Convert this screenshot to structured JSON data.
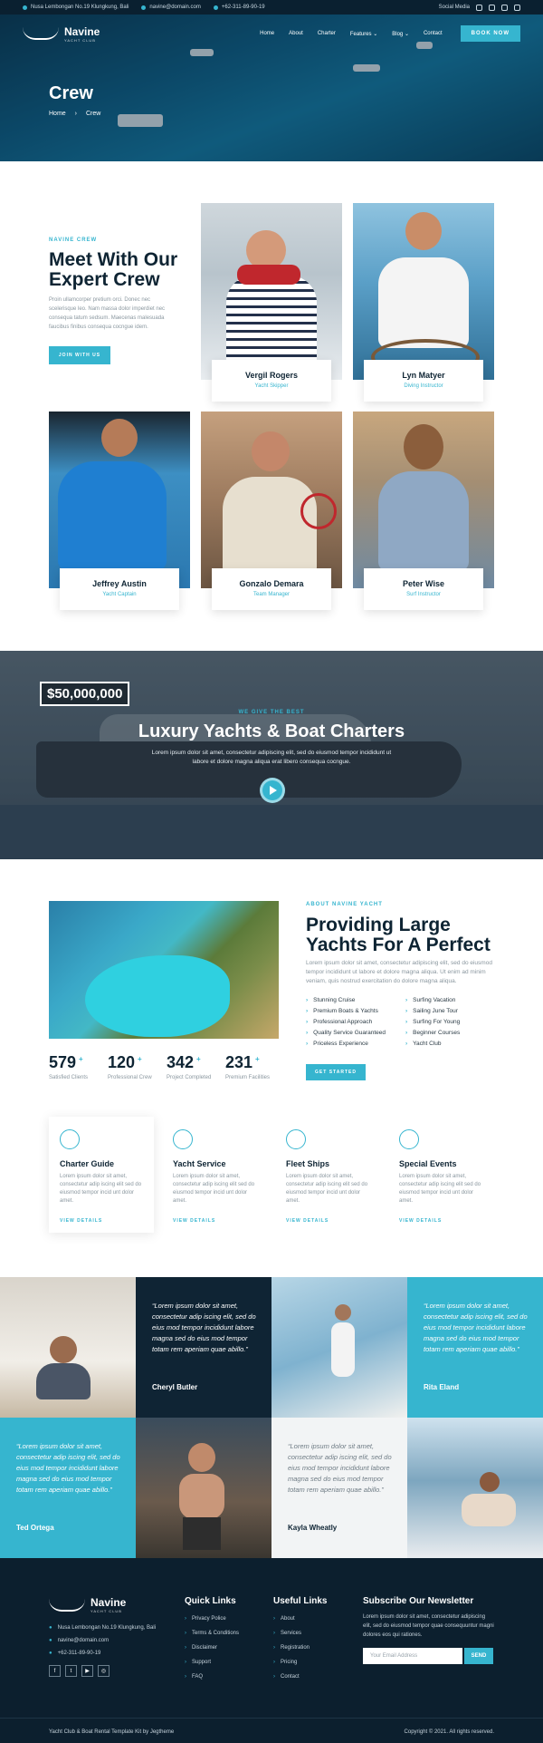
{
  "topbar": {
    "address": "Nusa Lembongan No.19 Klungkung, Bali",
    "email": "navine@domain.com",
    "phone": "+62-311-89-90-19",
    "social_label": "Social Media"
  },
  "brand": {
    "name": "Navine",
    "tagline": "YACHT CLUB"
  },
  "nav": {
    "items": [
      "Home",
      "About",
      "Charter",
      "Features",
      "Blog",
      "Contact"
    ],
    "cta": "BOOK NOW"
  },
  "hero": {
    "title": "Crew",
    "breadcrumb": [
      "Home",
      "Crew"
    ]
  },
  "crew_intro": {
    "eyebrow": "NAVINE CREW",
    "title": "Meet With Our Expert Crew",
    "text": "Proin ullamcorper pretium orci. Donec nec scelerisque leo. Nam massa dolor imperdiet nec consequa tatum sedsum. Maecenas malesuada faucibus finibus consequa cocngue idem.",
    "button": "JOIN WITH US"
  },
  "crew": [
    {
      "name": "Vergil Rogers",
      "role": "Yacht Skipper"
    },
    {
      "name": "Lyn Matyer",
      "role": "Diving Instructor"
    },
    {
      "name": "Jeffrey Austin",
      "role": "Yacht Captain"
    },
    {
      "name": "Gonzalo Demara",
      "role": "Team Manager"
    },
    {
      "name": "Peter Wise",
      "role": "Surf Instructor"
    }
  ],
  "promo": {
    "price": "$50,000,000",
    "eyebrow": "WE GIVE THE BEST",
    "title": "Luxury Yachts & Boat Charters",
    "text": "Lorem ipsum dolor sit amet, consectetur adipiscing elit, sed do eiusmod tempor incididunt ut labore et dolore magna aliqua erat libero consequa cocngue."
  },
  "about": {
    "eyebrow": "ABOUT NAVINE YACHT",
    "title": "Providing Large Yachts For A Perfect",
    "text": "Lorem ipsum dolor sit amet, consectetur adipiscing elit, sed do eiusmod tempor incididunt ut labore et dolore magna aliqua. Ut enim ad minim veniam, quis nostrud exercitation do dolore magna aliqua.",
    "features": [
      "Stunning Cruise",
      "Surfing Vacation",
      "Premium Boats & Yachts",
      "Sailing June Tour",
      "Professional Approach",
      "Surfing For Young",
      "Quality Service Guaranteed",
      "Beginner Courses",
      "Priceless Experience",
      "Yacht Club"
    ],
    "button": "GET STARTED"
  },
  "stats": [
    {
      "value": "579",
      "label": "Satisfied Clients"
    },
    {
      "value": "120",
      "label": "Professional Crew"
    },
    {
      "value": "342",
      "label": "Project Completed"
    },
    {
      "value": "231",
      "label": "Premium Facilities"
    }
  ],
  "services": [
    {
      "title": "Charter Guide",
      "text": "Lorem ipsum dolor sit amet, consectetur adip iscing elit sed do eiusmod tempor incid unt dolor amet.",
      "more": "VIEW DETAILS",
      "icon": "ship-wheel-icon"
    },
    {
      "title": "Yacht Service",
      "text": "Lorem ipsum dolor sit amet, consectetur adip iscing elit sed do eiusmod tempor incid unt dolor amet.",
      "more": "VIEW DETAILS",
      "icon": "boat-icon"
    },
    {
      "title": "Fleet Ships",
      "text": "Lorem ipsum dolor sit amet, consectetur adip iscing elit sed do eiusmod tempor incid unt dolor amet.",
      "more": "VIEW DETAILS",
      "icon": "anchor-icon"
    },
    {
      "title": "Special Events",
      "text": "Lorem ipsum dolor sit amet, consectetur adip iscing elit sed do eiusmod tempor incid unt dolor amet.",
      "more": "VIEW DETAILS",
      "icon": "badge-icon"
    }
  ],
  "testimonials": [
    {
      "quote": "“Lorem ipsum dolor sit amet, consectetur adip iscing elit, sed do eius mod tempor incididunt labore magna sed do eius mod tempor totam rem aperiam quae abillo.”",
      "name": "Cheryl Butler"
    },
    {
      "quote": "“Lorem ipsum dolor sit amet, consectetur adip iscing elit, sed do eius mod tempor incididunt labore magna sed do eius mod tempor totam rem aperiam quae abillo.”",
      "name": "Rita Eland"
    },
    {
      "quote": "“Lorem ipsum dolor sit amet, consectetur adip iscing elit, sed do eius mod tempor incididunt labore magna sed do eius mod tempor totam rem aperiam quae abillo.”",
      "name": "Ted Ortega"
    },
    {
      "quote": "“Lorem ipsum dolor sit amet, consectetur adip iscing elit, sed do eius mod tempor incididunt labore magna sed do eius mod tempor totam rem aperiam quae abillo.”",
      "name": "Kayla Wheatly"
    }
  ],
  "footer": {
    "address": "Nusa Lembongan No.19 Klungkung, Bali",
    "email": "navine@domain.com",
    "phone": "+62-311-89-90-19",
    "quick_title": "Quick Links",
    "quick": [
      "Privacy Police",
      "Terms & Conditions",
      "Disclaimer",
      "Support",
      "FAQ"
    ],
    "useful_title": "Useful Links",
    "useful": [
      "About",
      "Services",
      "Registration",
      "Pricing",
      "Contact"
    ],
    "news_title": "Subscribe Our Newsletter",
    "news_text": "Lorem ipsum dolor sit amet, consectetur adipiscing elit, sed do eiusmod tempor quae consequuntur magni dolores eos qui rationes.",
    "email_placeholder": "Your Email Address",
    "send": "SEND",
    "credit": "Yacht Club & Boat Rental Template Kit by Jegtheme",
    "copyright": "Copyright © 2021. All rights reserved."
  },
  "colors": {
    "accent": "#36b5cf",
    "dark": "#0c1f2e",
    "heading": "#0e2433"
  }
}
